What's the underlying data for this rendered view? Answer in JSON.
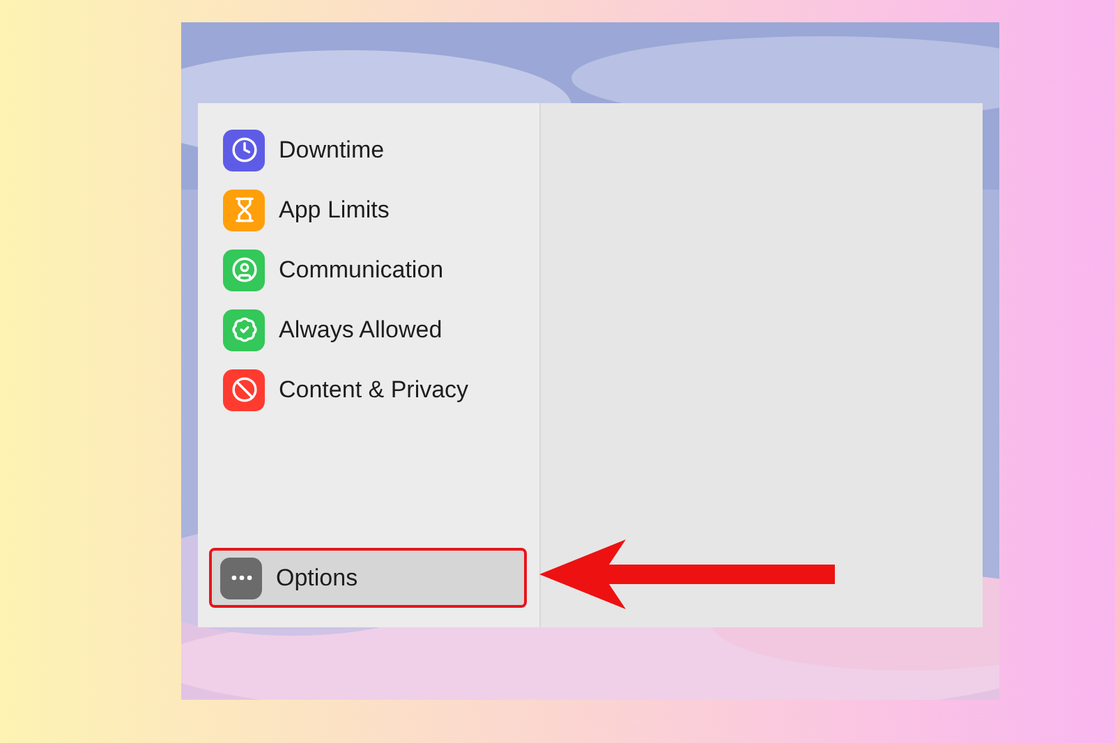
{
  "sidebar": {
    "items": [
      {
        "kind": "downtime",
        "label": "Downtime",
        "color": "#5e5ce6",
        "selected": false
      },
      {
        "kind": "limits",
        "label": "App Limits",
        "color": "#ff9f0a",
        "selected": false
      },
      {
        "kind": "communication",
        "label": "Communication",
        "color": "#34c759",
        "selected": false
      },
      {
        "kind": "allowed",
        "label": "Always Allowed",
        "color": "#34c759",
        "selected": false
      },
      {
        "kind": "privacy",
        "label": "Content & Privacy",
        "color": "#ff3b30",
        "selected": false
      }
    ],
    "footer_item": {
      "kind": "options",
      "label": "Options",
      "color": "#6b6b6b",
      "selected": true,
      "annotated": true
    }
  }
}
